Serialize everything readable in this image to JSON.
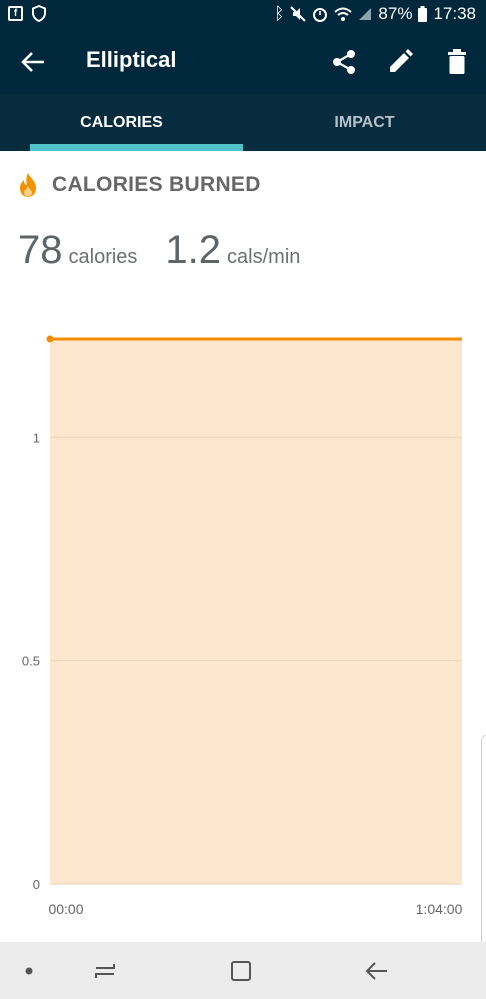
{
  "status_bar": {
    "battery_percent": "87%",
    "time": "17:38",
    "left_icons": [
      "facebook-icon",
      "shield-icon"
    ],
    "right_icons": [
      "bluetooth-icon",
      "mute-icon",
      "alarm-icon",
      "wifi-icon",
      "signal-icon",
      "battery-icon"
    ]
  },
  "app_bar": {
    "title": "Elliptical",
    "actions": [
      "share-icon",
      "edit-icon",
      "delete-icon"
    ]
  },
  "tabs": [
    {
      "label": "CALORIES",
      "active": true
    },
    {
      "label": "IMPACT",
      "active": false
    }
  ],
  "section": {
    "title": "CALORIES BURNED",
    "icon": "flame-icon"
  },
  "stats": [
    {
      "value": "78",
      "unit": "calories"
    },
    {
      "value": "1.2",
      "unit": "cals/min"
    }
  ],
  "colors": {
    "header_bg": "#00283c",
    "tab_indicator": "#4fc3c8",
    "line": "#f28c00",
    "fill": "#fde7cf",
    "flame": "#f39200"
  },
  "chart_data": {
    "type": "area",
    "x": [
      "00:00",
      "1:04:00"
    ],
    "series": [
      {
        "values": [
          1.22,
          1.22
        ]
      }
    ],
    "y_ticks": [
      "0",
      "0.5",
      "1"
    ],
    "x_ticks": [
      "00:00",
      "1:04:00"
    ],
    "ylim": [
      0,
      1.22
    ],
    "grid": true
  },
  "nav_bar": {
    "buttons": [
      "dot-icon",
      "recents-icon",
      "home-icon",
      "back-nav-icon"
    ]
  }
}
